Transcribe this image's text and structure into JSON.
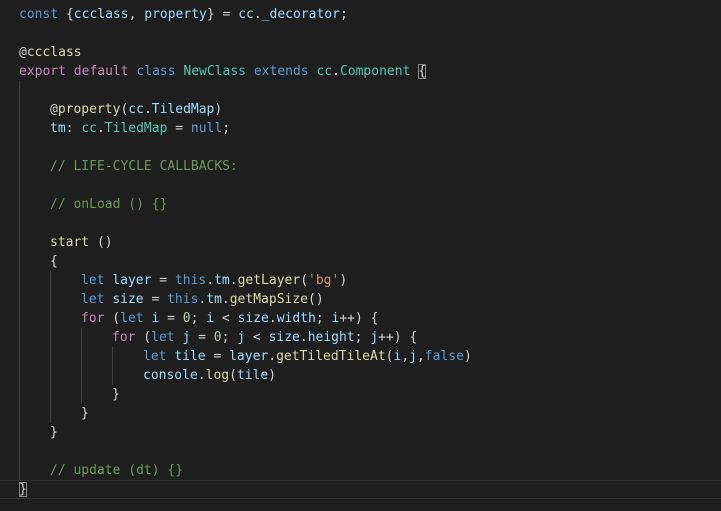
{
  "editor": {
    "language": "typescript",
    "theme": "dark",
    "colors": {
      "background": "#1e1e1e",
      "keyword": "#569cd6",
      "control": "#c586c0",
      "variable": "#9cdcfe",
      "function": "#dcdcaa",
      "class": "#4ec9b0",
      "string": "#ce9178",
      "number": "#b5cea8",
      "comment": "#6a9955",
      "text": "#d4d4d4"
    },
    "lines": [
      {
        "indent": 0,
        "guides": 0,
        "tokens": [
          {
            "t": "const",
            "c": "keyword"
          },
          {
            "t": " {"
          },
          {
            "t": "ccclass",
            "c": "variable"
          },
          {
            "t": ", "
          },
          {
            "t": "property",
            "c": "variable"
          },
          {
            "t": "} = "
          },
          {
            "t": "cc",
            "c": "variable"
          },
          {
            "t": "."
          },
          {
            "t": "_decorator",
            "c": "variable"
          },
          {
            "t": ";"
          }
        ]
      },
      {
        "indent": 0,
        "guides": 0,
        "tokens": []
      },
      {
        "indent": 0,
        "guides": 0,
        "tokens": [
          {
            "t": "@",
            "c": "text"
          },
          {
            "t": "ccclass",
            "c": "function"
          }
        ]
      },
      {
        "indent": 0,
        "guides": 0,
        "tokens": [
          {
            "t": "export",
            "c": "control"
          },
          {
            "t": " "
          },
          {
            "t": "default",
            "c": "control"
          },
          {
            "t": " "
          },
          {
            "t": "class",
            "c": "keyword"
          },
          {
            "t": " "
          },
          {
            "t": "NewClass",
            "c": "class"
          },
          {
            "t": " "
          },
          {
            "t": "extends",
            "c": "keyword"
          },
          {
            "t": " "
          },
          {
            "t": "cc",
            "c": "class"
          },
          {
            "t": "."
          },
          {
            "t": "Component",
            "c": "class"
          },
          {
            "t": " "
          },
          {
            "t": "{",
            "c": "bracket"
          }
        ]
      },
      {
        "indent": 1,
        "guides": 1,
        "tokens": []
      },
      {
        "indent": 1,
        "guides": 1,
        "tokens": [
          {
            "t": "@",
            "c": "text"
          },
          {
            "t": "property",
            "c": "function"
          },
          {
            "t": "("
          },
          {
            "t": "cc",
            "c": "variable"
          },
          {
            "t": "."
          },
          {
            "t": "TiledMap",
            "c": "variable"
          },
          {
            "t": ")"
          }
        ]
      },
      {
        "indent": 1,
        "guides": 1,
        "tokens": [
          {
            "t": "tm",
            "c": "variable"
          },
          {
            "t": ": "
          },
          {
            "t": "cc",
            "c": "class"
          },
          {
            "t": "."
          },
          {
            "t": "TiledMap",
            "c": "class"
          },
          {
            "t": " = "
          },
          {
            "t": "null",
            "c": "keyword"
          },
          {
            "t": ";"
          }
        ]
      },
      {
        "indent": 1,
        "guides": 1,
        "tokens": []
      },
      {
        "indent": 1,
        "guides": 1,
        "tokens": [
          {
            "t": "// LIFE-CYCLE CALLBACKS:",
            "c": "comment"
          }
        ]
      },
      {
        "indent": 1,
        "guides": 1,
        "tokens": []
      },
      {
        "indent": 1,
        "guides": 1,
        "tokens": [
          {
            "t": "// onLoad () {}",
            "c": "comment"
          }
        ]
      },
      {
        "indent": 1,
        "guides": 1,
        "tokens": []
      },
      {
        "indent": 1,
        "guides": 1,
        "tokens": [
          {
            "t": "start",
            "c": "function"
          },
          {
            "t": " ()"
          }
        ]
      },
      {
        "indent": 1,
        "guides": 1,
        "tokens": [
          {
            "t": "{"
          }
        ]
      },
      {
        "indent": 2,
        "guides": 2,
        "tokens": [
          {
            "t": "let",
            "c": "keyword"
          },
          {
            "t": " "
          },
          {
            "t": "layer",
            "c": "variable"
          },
          {
            "t": " = "
          },
          {
            "t": "this",
            "c": "keyword"
          },
          {
            "t": "."
          },
          {
            "t": "tm",
            "c": "variable"
          },
          {
            "t": "."
          },
          {
            "t": "getLayer",
            "c": "function"
          },
          {
            "t": "("
          },
          {
            "t": "'bg'",
            "c": "string"
          },
          {
            "t": ")"
          }
        ]
      },
      {
        "indent": 2,
        "guides": 2,
        "tokens": [
          {
            "t": "let",
            "c": "keyword"
          },
          {
            "t": " "
          },
          {
            "t": "size",
            "c": "variable"
          },
          {
            "t": " = "
          },
          {
            "t": "this",
            "c": "keyword"
          },
          {
            "t": "."
          },
          {
            "t": "tm",
            "c": "variable"
          },
          {
            "t": "."
          },
          {
            "t": "getMapSize",
            "c": "function"
          },
          {
            "t": "()"
          }
        ]
      },
      {
        "indent": 2,
        "guides": 2,
        "tokens": [
          {
            "t": "for",
            "c": "control"
          },
          {
            "t": " ("
          },
          {
            "t": "let",
            "c": "keyword"
          },
          {
            "t": " "
          },
          {
            "t": "i",
            "c": "variable"
          },
          {
            "t": " = "
          },
          {
            "t": "0",
            "c": "number"
          },
          {
            "t": "; "
          },
          {
            "t": "i",
            "c": "variable"
          },
          {
            "t": " < "
          },
          {
            "t": "size",
            "c": "variable"
          },
          {
            "t": "."
          },
          {
            "t": "width",
            "c": "variable"
          },
          {
            "t": "; "
          },
          {
            "t": "i",
            "c": "variable"
          },
          {
            "t": "++) {"
          }
        ]
      },
      {
        "indent": 3,
        "guides": 3,
        "tokens": [
          {
            "t": "for",
            "c": "control"
          },
          {
            "t": " ("
          },
          {
            "t": "let",
            "c": "keyword"
          },
          {
            "t": " "
          },
          {
            "t": "j",
            "c": "variable"
          },
          {
            "t": " = "
          },
          {
            "t": "0",
            "c": "number"
          },
          {
            "t": "; "
          },
          {
            "t": "j",
            "c": "variable"
          },
          {
            "t": " < "
          },
          {
            "t": "size",
            "c": "variable"
          },
          {
            "t": "."
          },
          {
            "t": "height",
            "c": "variable"
          },
          {
            "t": "; "
          },
          {
            "t": "j",
            "c": "variable"
          },
          {
            "t": "++) {"
          }
        ]
      },
      {
        "indent": 4,
        "guides": 4,
        "tokens": [
          {
            "t": "let",
            "c": "keyword"
          },
          {
            "t": " "
          },
          {
            "t": "tile",
            "c": "variable"
          },
          {
            "t": " = "
          },
          {
            "t": "layer",
            "c": "variable"
          },
          {
            "t": "."
          },
          {
            "t": "getTiledTileAt",
            "c": "function"
          },
          {
            "t": "("
          },
          {
            "t": "i",
            "c": "variable"
          },
          {
            "t": ","
          },
          {
            "t": "j",
            "c": "variable"
          },
          {
            "t": ","
          },
          {
            "t": "false",
            "c": "keyword"
          },
          {
            "t": ")"
          }
        ]
      },
      {
        "indent": 4,
        "guides": 4,
        "tokens": [
          {
            "t": "console",
            "c": "variable"
          },
          {
            "t": "."
          },
          {
            "t": "log",
            "c": "function"
          },
          {
            "t": "("
          },
          {
            "t": "tile",
            "c": "variable"
          },
          {
            "t": ")"
          }
        ]
      },
      {
        "indent": 3,
        "guides": 3,
        "tokens": [
          {
            "t": "}"
          }
        ]
      },
      {
        "indent": 2,
        "guides": 2,
        "tokens": [
          {
            "t": "}"
          }
        ]
      },
      {
        "indent": 1,
        "guides": 1,
        "tokens": [
          {
            "t": "}"
          }
        ]
      },
      {
        "indent": 1,
        "guides": 1,
        "tokens": []
      },
      {
        "indent": 1,
        "guides": 1,
        "tokens": [
          {
            "t": "// update (dt) {}",
            "c": "comment"
          }
        ]
      },
      {
        "indent": 0,
        "guides": 0,
        "current": true,
        "tokens": [
          {
            "t": "}",
            "c": "bracket"
          }
        ]
      }
    ]
  }
}
